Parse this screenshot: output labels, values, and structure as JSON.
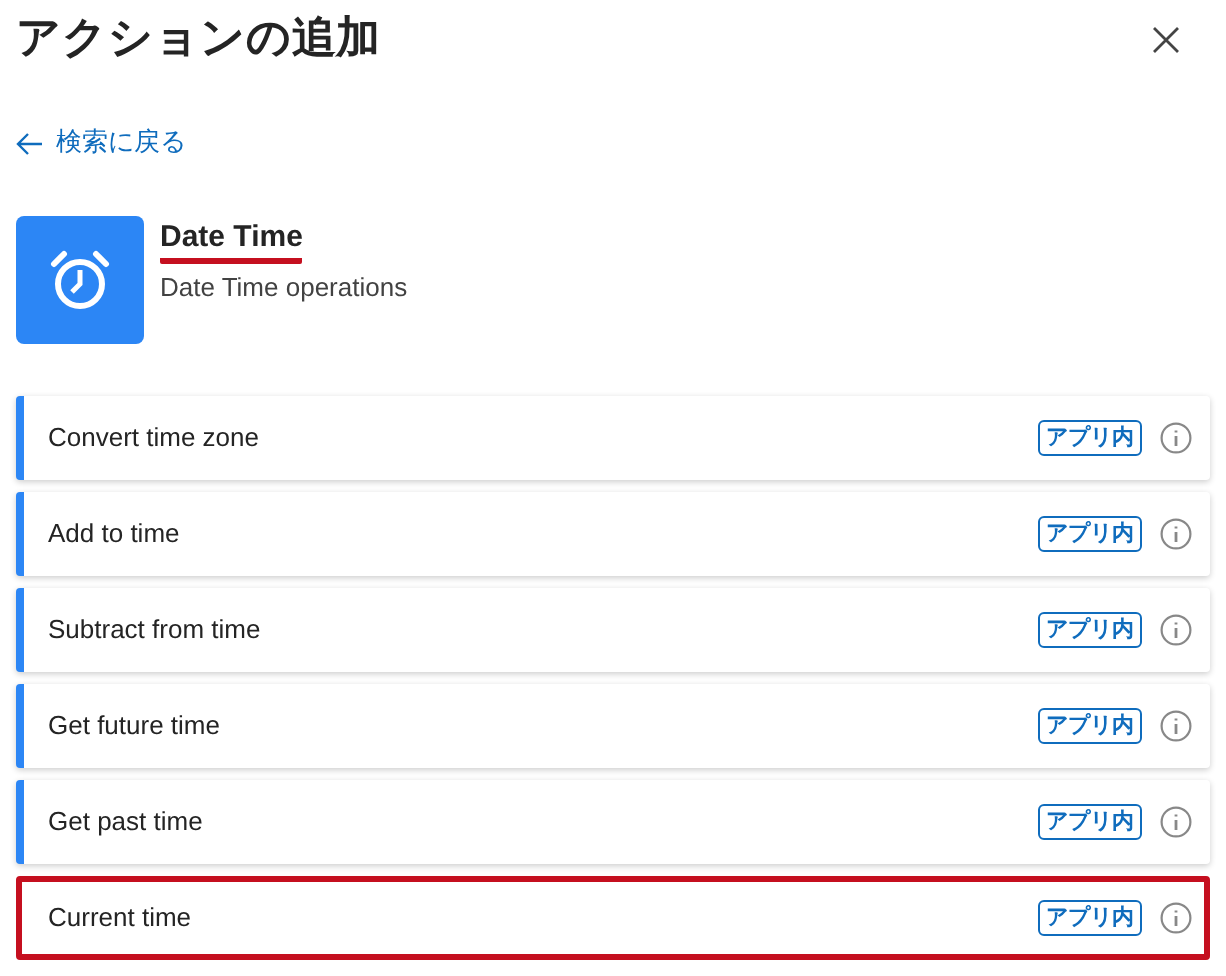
{
  "panel": {
    "title": "アクションの追加"
  },
  "back_link": {
    "label": "検索に戻る"
  },
  "connector": {
    "name": "Date Time",
    "underlined": true,
    "description": "Date Time operations"
  },
  "actions": [
    {
      "name": "Convert time zone",
      "badge": "アプリ内",
      "highlighted": false
    },
    {
      "name": "Add to time",
      "badge": "アプリ内",
      "highlighted": false
    },
    {
      "name": "Subtract from time",
      "badge": "アプリ内",
      "highlighted": false
    },
    {
      "name": "Get future time",
      "badge": "アプリ内",
      "highlighted": false
    },
    {
      "name": "Get past time",
      "badge": "アプリ内",
      "highlighted": false
    },
    {
      "name": "Current time",
      "badge": "アプリ内",
      "highlighted": true
    }
  ]
}
